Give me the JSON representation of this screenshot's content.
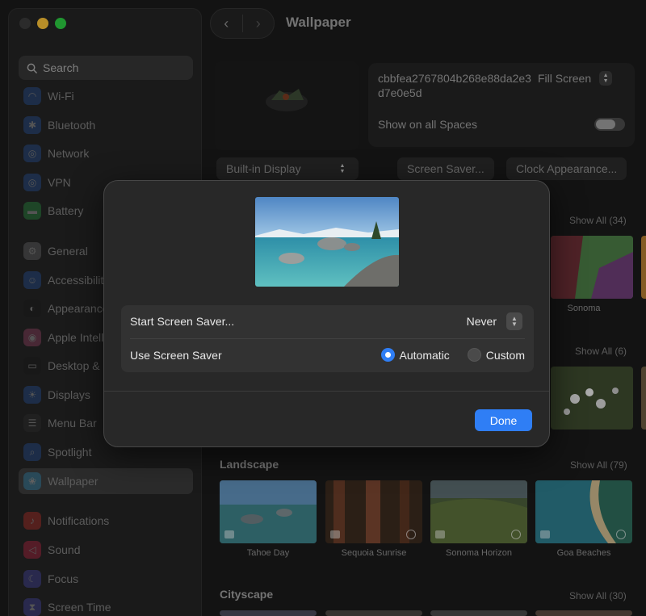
{
  "window": {
    "title": "Wallpaper"
  },
  "sidebar": {
    "search_placeholder": "Search",
    "items": [
      {
        "label": "Wi-Fi",
        "icon": "wifi-icon",
        "color": "#2f6fd6"
      },
      {
        "label": "Bluetooth",
        "icon": "bluetooth-icon",
        "color": "#2f6fd6"
      },
      {
        "label": "Network",
        "icon": "globe-icon",
        "color": "#2f6fd6"
      },
      {
        "label": "VPN",
        "icon": "vpn-globe-icon",
        "color": "#2f6fd6"
      },
      {
        "label": "Battery",
        "icon": "battery-icon",
        "color": "#34c759"
      },
      {
        "label": "General",
        "icon": "gear-icon",
        "color": "#8e8e93"
      },
      {
        "label": "Accessibility",
        "icon": "accessibility-icon",
        "color": "#2f6fd6"
      },
      {
        "label": "Appearance",
        "icon": "appearance-icon",
        "color": "#1c1c1e"
      },
      {
        "label": "Apple Intelligence & Siri",
        "icon": "siri-icon",
        "color": "#d15a8a"
      },
      {
        "label": "Desktop & Dock",
        "icon": "dock-icon",
        "color": "#1c1c1e"
      },
      {
        "label": "Displays",
        "icon": "sun-icon",
        "color": "#2f6fd6"
      },
      {
        "label": "Menu Bar",
        "icon": "menu-bar-icon",
        "color": "#3a3a3c"
      },
      {
        "label": "Spotlight",
        "icon": "spotlight-icon",
        "color": "#2f6fd6"
      },
      {
        "label": "Wallpaper",
        "icon": "wallpaper-icon",
        "color": "#32ade6"
      },
      {
        "label": "Notifications",
        "icon": "bell-icon",
        "color": "#ff3b30"
      },
      {
        "label": "Sound",
        "icon": "speaker-icon",
        "color": "#ff2d55"
      },
      {
        "label": "Focus",
        "icon": "moon-icon",
        "color": "#5e5ce6"
      },
      {
        "label": "Screen Time",
        "icon": "hourglass-icon",
        "color": "#5e5ce6"
      }
    ]
  },
  "current_wallpaper": {
    "name": "cbbfea2767804b268e88da2e3d7e0e5d",
    "fill_mode": "Fill Screen",
    "show_all_spaces_label": "Show on all Spaces",
    "show_all_spaces_on": false,
    "display_selector": "Built-in Display",
    "screen_saver_button": "Screen Saver...",
    "clock_button": "Clock Appearance..."
  },
  "sections": {
    "first_show_all": "Show All (34)",
    "sonoma_caption": "Sonoma",
    "second_show_all": "Show All (6)",
    "landscape": {
      "title": "Landscape",
      "show_all": "Show All (79)",
      "tiles": [
        {
          "caption": "Tahoe Day"
        },
        {
          "caption": "Sequoia Sunrise"
        },
        {
          "caption": "Sonoma Horizon"
        },
        {
          "caption": "Goa Beaches"
        }
      ]
    },
    "cityscape": {
      "title": "Cityscape",
      "show_all": "Show All (30)"
    }
  },
  "sheet": {
    "start_label": "Start Screen Saver...",
    "start_value": "Never",
    "use_label": "Use Screen Saver",
    "option_automatic": "Automatic",
    "option_custom": "Custom",
    "selected_option": "Automatic",
    "done_label": "Done"
  },
  "colors": {
    "accent": "#2f7ef5"
  }
}
